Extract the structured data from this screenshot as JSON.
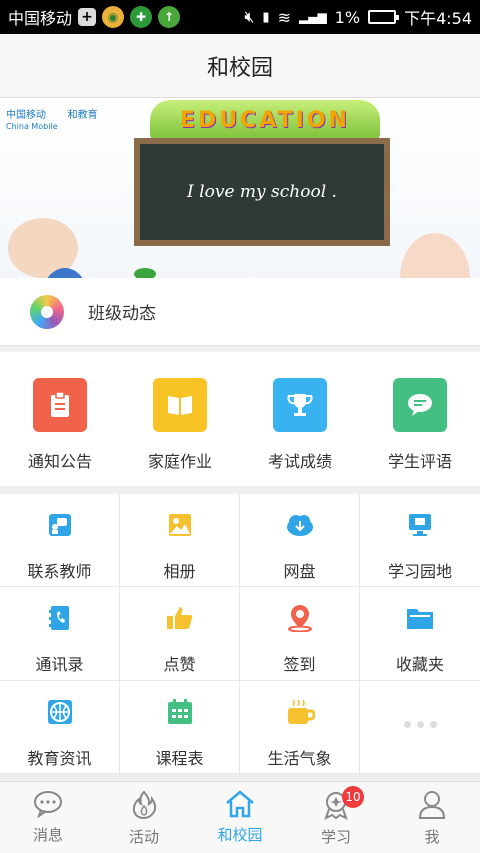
{
  "status_bar": {
    "carrier": "中国移动",
    "battery": "1%",
    "time": "下午4:54"
  },
  "header": {
    "title": "和校园"
  },
  "banner": {
    "logo1": "中国移动",
    "logo1_sub": "China Mobile",
    "logo2": "和教育",
    "sign": "EDUCATION",
    "board_text": "I love my school ."
  },
  "class_row": {
    "label": "班级动态"
  },
  "main_grid": [
    {
      "label": "通知公告",
      "color": "#f0624a",
      "icon": "clipboard-icon"
    },
    {
      "label": "家庭作业",
      "color": "#f7c325",
      "icon": "book-icon"
    },
    {
      "label": "考试成绩",
      "color": "#38b3f0",
      "icon": "trophy-icon"
    },
    {
      "label": "学生评语",
      "color": "#43c081",
      "icon": "chat-icon"
    }
  ],
  "sub_grid": [
    {
      "label": "联系教师",
      "icon": "contact-teacher-icon",
      "color": "#2fa5e8"
    },
    {
      "label": "相册",
      "icon": "photo-icon",
      "color": "#f5c12e"
    },
    {
      "label": "网盘",
      "icon": "cloud-download-icon",
      "color": "#2fa5e8"
    },
    {
      "label": "学习园地",
      "icon": "monitor-icon",
      "color": "#2fa5e8"
    },
    {
      "label": "通讯录",
      "icon": "phonebook-icon",
      "color": "#2fa5e8"
    },
    {
      "label": "点赞",
      "icon": "thumbs-up-icon",
      "color": "#f5c12e"
    },
    {
      "label": "签到",
      "icon": "location-icon",
      "color": "#f0624a"
    },
    {
      "label": "收藏夹",
      "icon": "folder-icon",
      "color": "#2fa5e8"
    },
    {
      "label": "教育资讯",
      "icon": "basketball-icon",
      "color": "#2fa5e8"
    },
    {
      "label": "课程表",
      "icon": "calendar-icon",
      "color": "#43c081"
    },
    {
      "label": "生活气象",
      "icon": "coffee-icon",
      "color": "#f5c12e"
    }
  ],
  "bottom_nav": [
    {
      "label": "消息",
      "icon": "message-icon"
    },
    {
      "label": "活动",
      "icon": "flame-icon"
    },
    {
      "label": "和校园",
      "icon": "home-icon",
      "active": true
    },
    {
      "label": "学习",
      "icon": "learn-icon",
      "badge": "10"
    },
    {
      "label": "我",
      "icon": "person-icon"
    }
  ],
  "colors": {
    "accent": "#2fa5e8",
    "badge": "#ef3b3b"
  }
}
